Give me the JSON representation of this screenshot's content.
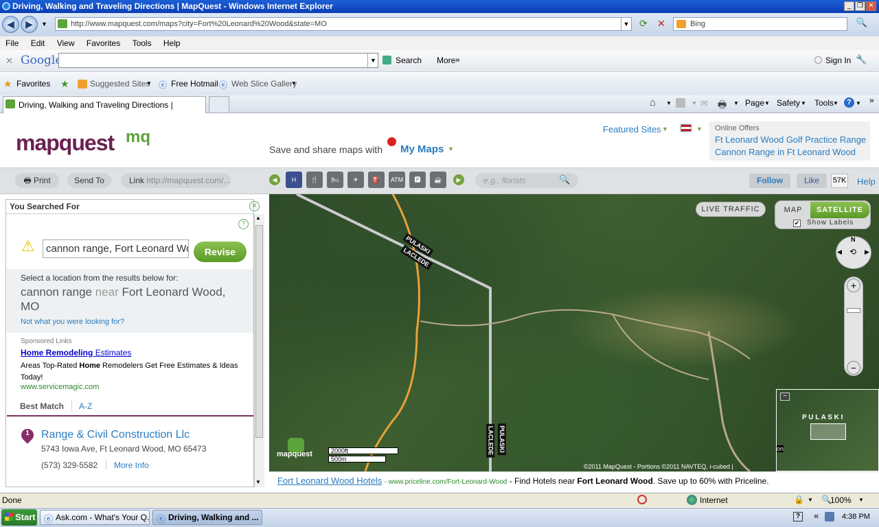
{
  "window": {
    "title": "Driving, Walking and Traveling Directions | MapQuest - Windows Internet Explorer"
  },
  "address": {
    "url": "http://www.mapquest.com/maps?city=Fort%20Leonard%20Wood&state=MO",
    "search_placeholder": "Bing"
  },
  "menu": [
    "File",
    "Edit",
    "View",
    "Favorites",
    "Tools",
    "Help"
  ],
  "google_bar": {
    "logo": "Google",
    "search_label": "Search",
    "more_label": "More",
    "sign_in": "Sign In"
  },
  "favorites": {
    "label": "Favorites",
    "items": [
      "Suggested Sites",
      "Free Hotmail",
      "Web Slice Gallery"
    ]
  },
  "tab": {
    "title": "Driving, Walking and Traveling Directions | MapQuest"
  },
  "cmdbar": [
    "Page",
    "Safety",
    "Tools"
  ],
  "header": {
    "logo": "mapquest",
    "logo_mark": "mq",
    "featured_sites": "Featured Sites",
    "save_share": "Save and share maps with",
    "my_maps": "My Maps",
    "online_offers_title": "Online Offers",
    "offers": [
      "Ft Leonard Wood Golf Practice Range",
      "Cannon Range in Ft Leonard Wood"
    ]
  },
  "toolbar": {
    "print": "Print",
    "send_to": "Send To",
    "link_label": "Link",
    "link_value": "http://mapquest.com/...",
    "categories": [
      "H",
      "🍴",
      "🛏",
      "✈",
      "⛽",
      "ATM",
      "🅿",
      "☕"
    ],
    "search_placeholder": "e.g., florists",
    "follow": "Follow",
    "like": "Like",
    "like_count": "57K",
    "help": "Help"
  },
  "panel": {
    "title": "You Searched For",
    "query": "cannon range, Fort Leonard Wood",
    "revise": "Revise",
    "select_prompt": "Select a location from the results below for:",
    "what": "cannon range",
    "near": "near",
    "where": "Fort Leonard Wood, MO",
    "not_what": "Not what you were looking for?",
    "sponsored": "Sponsored Links",
    "ad_title_strong": "Home Remodeling",
    "ad_title_rest": " Estimates",
    "ad_text_1": "Areas Top-Rated ",
    "ad_text_bold": "Home",
    "ad_text_2": " Remodelers Get Free Estimates & Ideas Today!",
    "ad_url": "www.servicemagic.com",
    "sort_best": "Best Match",
    "sort_az": "A-Z",
    "result": {
      "number": "1",
      "name": "Range & Civil Construction Llc",
      "address": "5743 Iowa Ave, Ft Leonard Wood, MO 65473",
      "phone": "(573) 329-5582",
      "more": "More Info"
    }
  },
  "map": {
    "live_traffic": "LIVE TRAFFIC",
    "map_btn": "MAP",
    "satellite_btn": "SATELLITE",
    "show_labels": "Show Labels",
    "compass_n": "N",
    "road_labels": [
      "PULASKI",
      "LACLEDE",
      "LACLEDE",
      "PULASKI"
    ],
    "scale_ft": "2000ft",
    "scale_m": "500m",
    "copyright": "©2011 MapQuest  -  Portions ©2011 NAVTEQ, i-cubed |",
    "mini_label": "P U L A S K I",
    "mini_on": "on",
    "logo": "mapquest"
  },
  "bottom_ad": {
    "link": "Fort Leonard Wood Hotels",
    "url": "- www.priceline.com/Fort-Leonard-Wood",
    "text_1": " - Find Hotels near ",
    "text_bold": "Fort Leonard Wood",
    "text_2": ". Save up to 60% with Priceline."
  },
  "status": {
    "text": "Done",
    "zone": "Internet",
    "zoom": "100%"
  },
  "taskbar": {
    "start": "Start",
    "items": [
      "Ask.com - What's Your Q...",
      "Driving, Walking and ..."
    ],
    "time": "4:38 PM"
  }
}
